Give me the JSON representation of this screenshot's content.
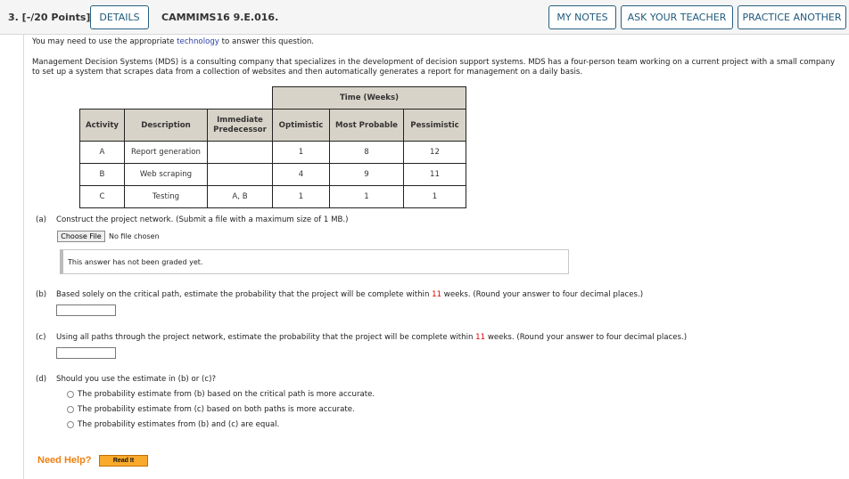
{
  "header": {
    "question_number": "3. [-/20 Points]",
    "details_label": "DETAILS",
    "question_code": "CAMMIMS16 9.E.016.",
    "my_notes_label": "MY NOTES",
    "ask_teacher_label": "ASK YOUR TEACHER",
    "practice_another_label": "PRACTICE ANOTHER"
  },
  "intro": {
    "tech_prefix": "You may need to use the appropriate ",
    "tech_link": "technology",
    "tech_suffix": " to answer this question.",
    "paragraph_line1": "Management Decision Systems (MDS) is a consulting company that specializes in the development of decision support systems. MDS has a four-person team working on a current project with a small company",
    "paragraph_line2": "to set up a system that scrapes data from a collection of websites and then automatically generates a report for management on a daily basis."
  },
  "table": {
    "group_header": "Time (Weeks)",
    "columns": [
      "Activity",
      "Description",
      "Immediate Predecessor",
      "Optimistic",
      "Most Probable",
      "Pessimistic"
    ],
    "rows": [
      {
        "activity": "A",
        "description": "Report generation",
        "predecessor": "",
        "optimistic": "1",
        "most_probable": "8",
        "pessimistic": "12"
      },
      {
        "activity": "B",
        "description": "Web scraping",
        "predecessor": "",
        "optimistic": "4",
        "most_probable": "9",
        "pessimistic": "11"
      },
      {
        "activity": "C",
        "description": "Testing",
        "predecessor": "A, B",
        "optimistic": "1",
        "most_probable": "1",
        "pessimistic": "1"
      }
    ]
  },
  "part_a": {
    "label": "(a)",
    "text": "Construct the project network. (Submit a file with a maximum size of 1 MB.)",
    "choose_file_label": "Choose File",
    "file_status": "No file chosen",
    "graded_status": "This answer has not been graded yet."
  },
  "part_b": {
    "label": "(b)",
    "text_before": "Based solely on the critical path, estimate the probability that the project will be complete within ",
    "weeks": "11",
    "text_after": " weeks. (Round your answer to four decimal places.)",
    "value": ""
  },
  "part_c": {
    "label": "(c)",
    "text_before": "Using all paths through the project network, estimate the probability that the project will be complete within ",
    "weeks": "11",
    "text_after": " weeks. (Round your answer to four decimal places.)",
    "value": ""
  },
  "part_d": {
    "label": "(d)",
    "text": "Should you use the estimate in (b) or (c)?",
    "options": [
      "The probability estimate from (b) based on the critical path is more accurate.",
      "The probability estimate from (c) based on both paths is more accurate.",
      "The probability estimates from (b) and (c) are equal."
    ]
  },
  "help": {
    "need_help_label": "Need Help?",
    "read_it_label": "Read It"
  }
}
